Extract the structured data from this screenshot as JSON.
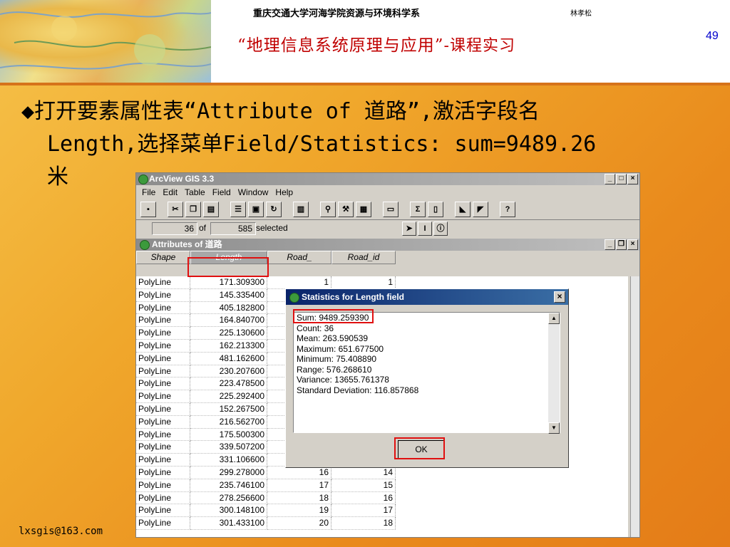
{
  "header": {
    "institution": "重庆交通大学河海学院资源与环境科学系",
    "author": "林孝松",
    "course_title": "“地理信息系统原理与应用”",
    "course_suffix": "-课程实习",
    "page_number": "49"
  },
  "instruction": {
    "line1": "◆打开要素属性表“Attribute of 道路”,激活字段名",
    "line2": "Length,选择菜单Field/Statistics:  sum=9489.26",
    "line3": "米"
  },
  "footer": {
    "email": "lxsgis@163.com"
  },
  "app": {
    "title": "ArcView GIS 3.3",
    "menus": [
      "File",
      "Edit",
      "Table",
      "Field",
      "Window",
      "Help"
    ],
    "selection": {
      "selected": "36",
      "of_label": "of",
      "total": "585",
      "selected_label": "selected"
    }
  },
  "table": {
    "title": "Attributes of 道路",
    "columns": [
      "Shape",
      "Length",
      "Road_",
      "Road_id"
    ],
    "rows": [
      [
        "PolyLine",
        "171.309300",
        "1",
        "1"
      ],
      [
        "PolyLine",
        "145.335400",
        "",
        ""
      ],
      [
        "PolyLine",
        "405.182800",
        "",
        ""
      ],
      [
        "PolyLine",
        "164.840700",
        "",
        ""
      ],
      [
        "PolyLine",
        "225.130600",
        "",
        ""
      ],
      [
        "PolyLine",
        "162.213300",
        "",
        ""
      ],
      [
        "PolyLine",
        "481.162600",
        "",
        ""
      ],
      [
        "PolyLine",
        "230.207600",
        "",
        ""
      ],
      [
        "PolyLine",
        "223.478500",
        "",
        ""
      ],
      [
        "PolyLine",
        "225.292400",
        "",
        ""
      ],
      [
        "PolyLine",
        "152.267500",
        "",
        ""
      ],
      [
        "PolyLine",
        "216.562700",
        "",
        ""
      ],
      [
        "PolyLine",
        "175.500300",
        "",
        ""
      ],
      [
        "PolyLine",
        "339.507200",
        "",
        ""
      ],
      [
        "PolyLine",
        "331.106600",
        "",
        ""
      ],
      [
        "PolyLine",
        "299.278000",
        "16",
        "14"
      ],
      [
        "PolyLine",
        "235.746100",
        "17",
        "15"
      ],
      [
        "PolyLine",
        "278.256600",
        "18",
        "16"
      ],
      [
        "PolyLine",
        "300.148100",
        "19",
        "17"
      ],
      [
        "PolyLine",
        "301.433100",
        "20",
        "18"
      ]
    ]
  },
  "dialog": {
    "title": "Statistics for Length field",
    "close": "×",
    "lines": [
      "Sum: 9489.259390",
      "Count: 36",
      "Mean: 263.590539",
      "Maximum: 651.677500",
      "Minimum: 75.408890",
      "Range: 576.268610",
      "Variance: 13655.761378",
      "Standard Deviation: 116.857868"
    ],
    "ok": "OK"
  }
}
